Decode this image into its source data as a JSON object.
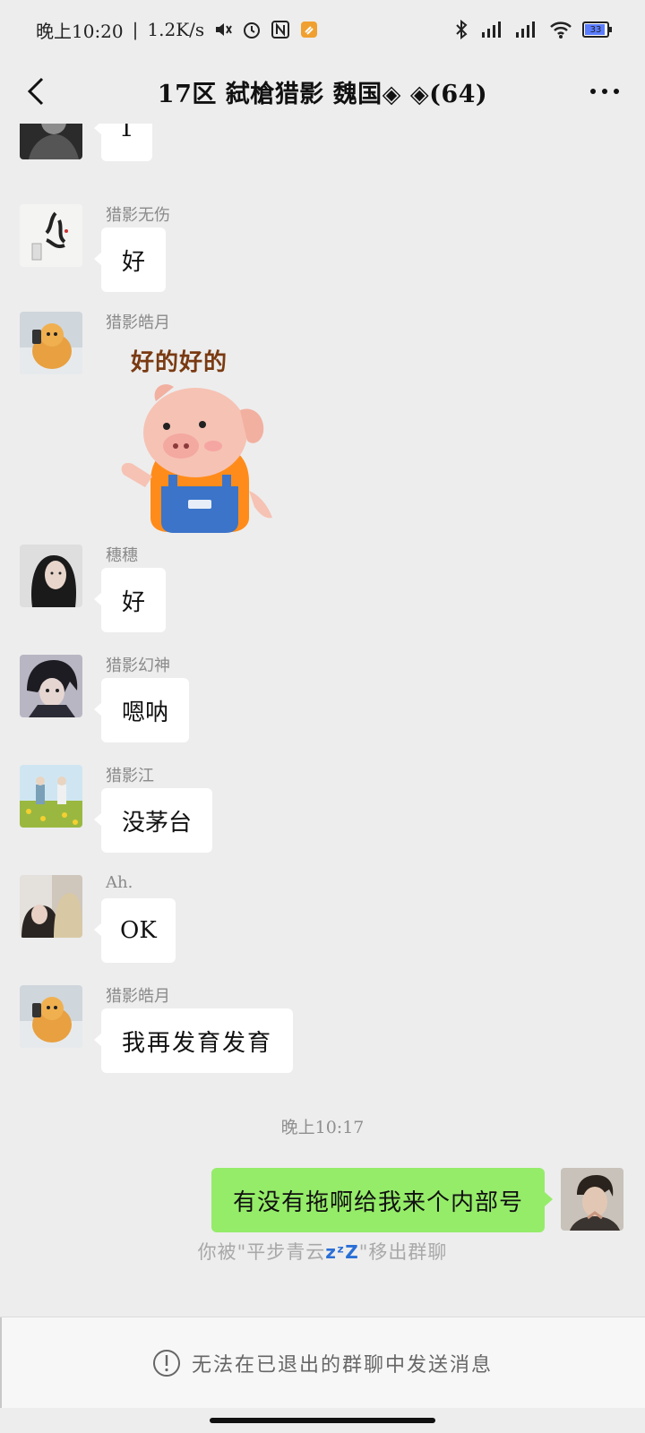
{
  "status_bar": {
    "time": "晚上10:20",
    "separator": "|",
    "speed": "1.2K/s",
    "battery_level": "33"
  },
  "header": {
    "title": "17区 弑槍猎影 魏国◈ ◈(64)"
  },
  "messages": [
    {
      "sender": "",
      "text": "1",
      "avatar_icon": "dark-figure-avatar"
    },
    {
      "sender": "猎影无伤",
      "text": "好",
      "avatar_icon": "calligraphy-avatar"
    },
    {
      "sender": "猎影皓月",
      "text": "",
      "sticker_text": "好的好的",
      "sticker_icon": "pig-sticker-icon",
      "avatar_icon": "orange-cat-avatar"
    },
    {
      "sender": "穗穗",
      "text": "好",
      "avatar_icon": "girl-avatar"
    },
    {
      "sender": "猎影幻神",
      "text": "嗯呐",
      "avatar_icon": "anime-boy-avatar"
    },
    {
      "sender": "猎影江",
      "text": "没茅台",
      "avatar_icon": "flower-field-avatar"
    },
    {
      "sender": "Ah.",
      "text": "OK",
      "avatar_icon": "couple-avatar"
    },
    {
      "sender": "猎影皓月",
      "text": "我再发育发育",
      "avatar_icon": "orange-cat-avatar"
    }
  ],
  "timestamp": "晚上10:17",
  "my_message": {
    "text": "有没有拖啊给我来个内部号",
    "avatar_icon": "my-avatar"
  },
  "system_message": {
    "prefix": "你被\"平步青云",
    "zzz": "zᶻZ",
    "suffix": "\"移出群聊"
  },
  "bottom_notice": "无法在已退出的群聊中发送消息",
  "colors": {
    "background": "#ededed",
    "my_bubble": "#95ec69",
    "other_bubble": "#ffffff",
    "zzz_accent": "#2a6fd6"
  }
}
